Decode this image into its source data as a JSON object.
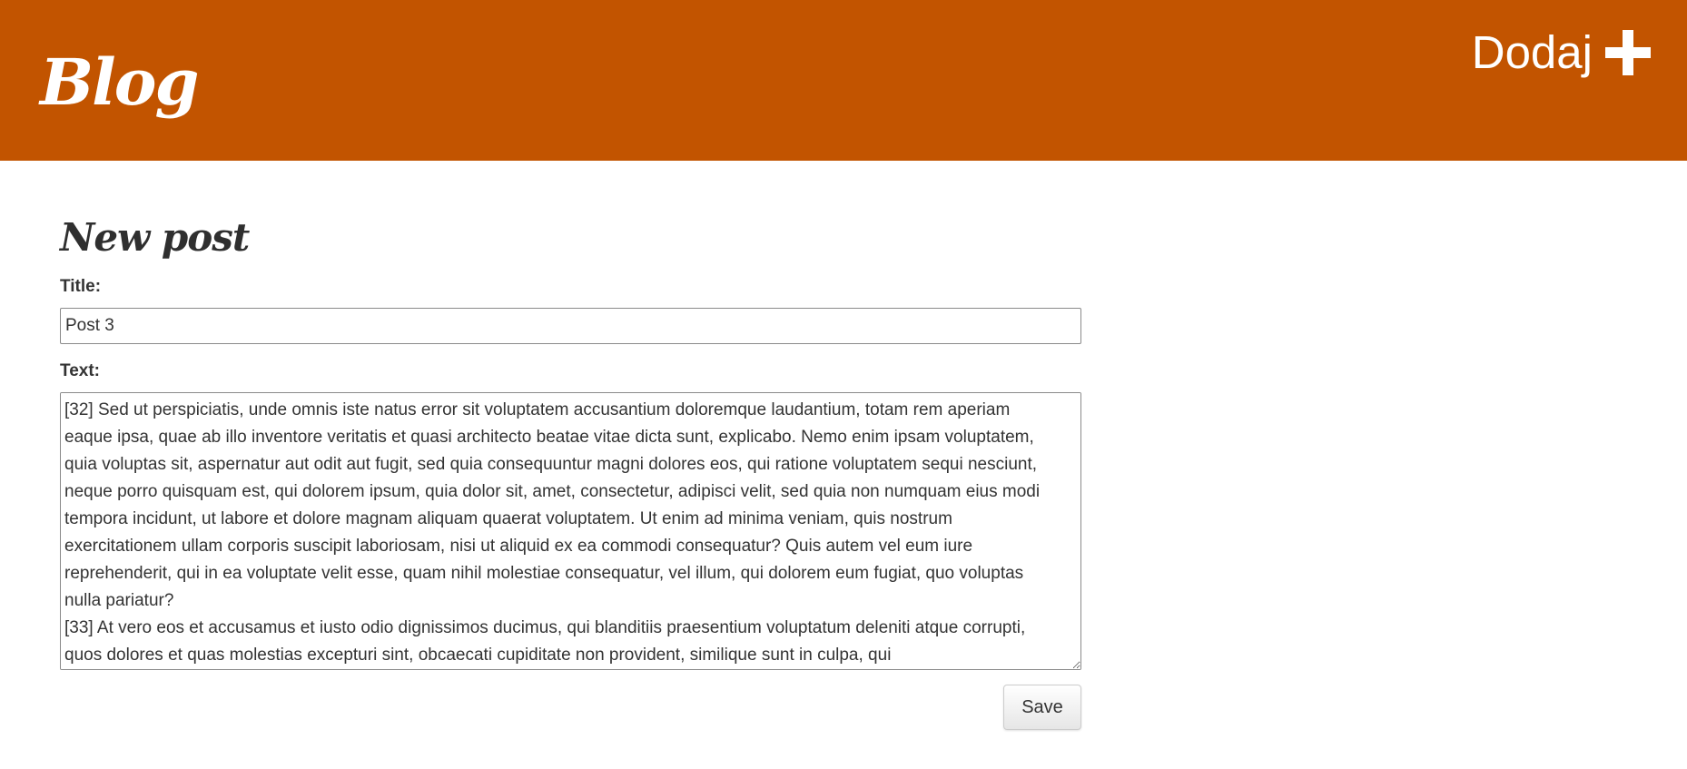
{
  "header": {
    "brand": "Blog",
    "add_label": "Dodaj",
    "accent_color": "#c25400"
  },
  "main": {
    "page_title": "New post",
    "title_label": "Title:",
    "title_value": "Post 3",
    "text_label": "Text:",
    "text_value": "[32] Sed ut perspiciatis, unde omnis iste natus error sit voluptatem accusantium doloremque laudantium, totam rem aperiam eaque ipsa, quae ab illo inventore veritatis et quasi architecto beatae vitae dicta sunt, explicabo. Nemo enim ipsam voluptatem, quia voluptas sit, aspernatur aut odit aut fugit, sed quia consequuntur magni dolores eos, qui ratione voluptatem sequi nesciunt, neque porro quisquam est, qui dolorem ipsum, quia dolor sit, amet, consectetur, adipisci velit, sed quia non numquam eius modi tempora incidunt, ut labore et dolore magnam aliquam quaerat voluptatem. Ut enim ad minima veniam, quis nostrum exercitationem ullam corporis suscipit laboriosam, nisi ut aliquid ex ea commodi consequatur? Quis autem vel eum iure reprehenderit, qui in ea voluptate velit esse, quam nihil molestiae consequatur, vel illum, qui dolorem eum fugiat, quo voluptas nulla pariatur?\n[33] At vero eos et accusamus et iusto odio dignissimos ducimus, qui blanditiis praesentium voluptatum deleniti atque corrupti, quos dolores et quas molestias excepturi sint, obcaecati cupiditate non provident, similique sunt in culpa, qui",
    "save_label": "Save"
  },
  "icons": {
    "add": "plus-icon"
  }
}
